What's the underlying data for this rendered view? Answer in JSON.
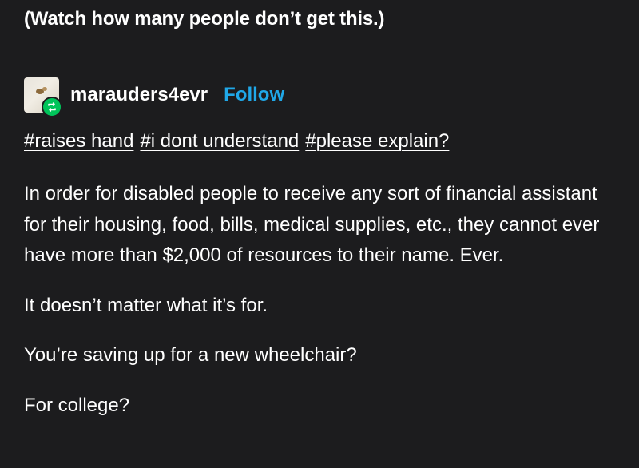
{
  "top_line": "(Watch how many people don’t get this.)",
  "reblog": {
    "username": "marauders4evr",
    "follow_label": "Follow",
    "avatar_icon": "avatar-image",
    "badge_icon": "reblog-icon",
    "badge_color": "#00c45a"
  },
  "tags": [
    "#raises hand",
    "#i dont understand",
    "#please explain?"
  ],
  "paragraphs": [
    "In order for disabled people to receive any sort of financial assistant for their housing, food, bills, medical supplies, etc., they cannot ever have more than $2,000 of resources to their name. Ever.",
    "It doesn’t matter what it’s for.",
    "You’re saving up for a new wheelchair?",
    "For college?"
  ],
  "colors": {
    "background": "#1c1c1e",
    "text": "#ffffff",
    "follow": "#20a8e8"
  }
}
